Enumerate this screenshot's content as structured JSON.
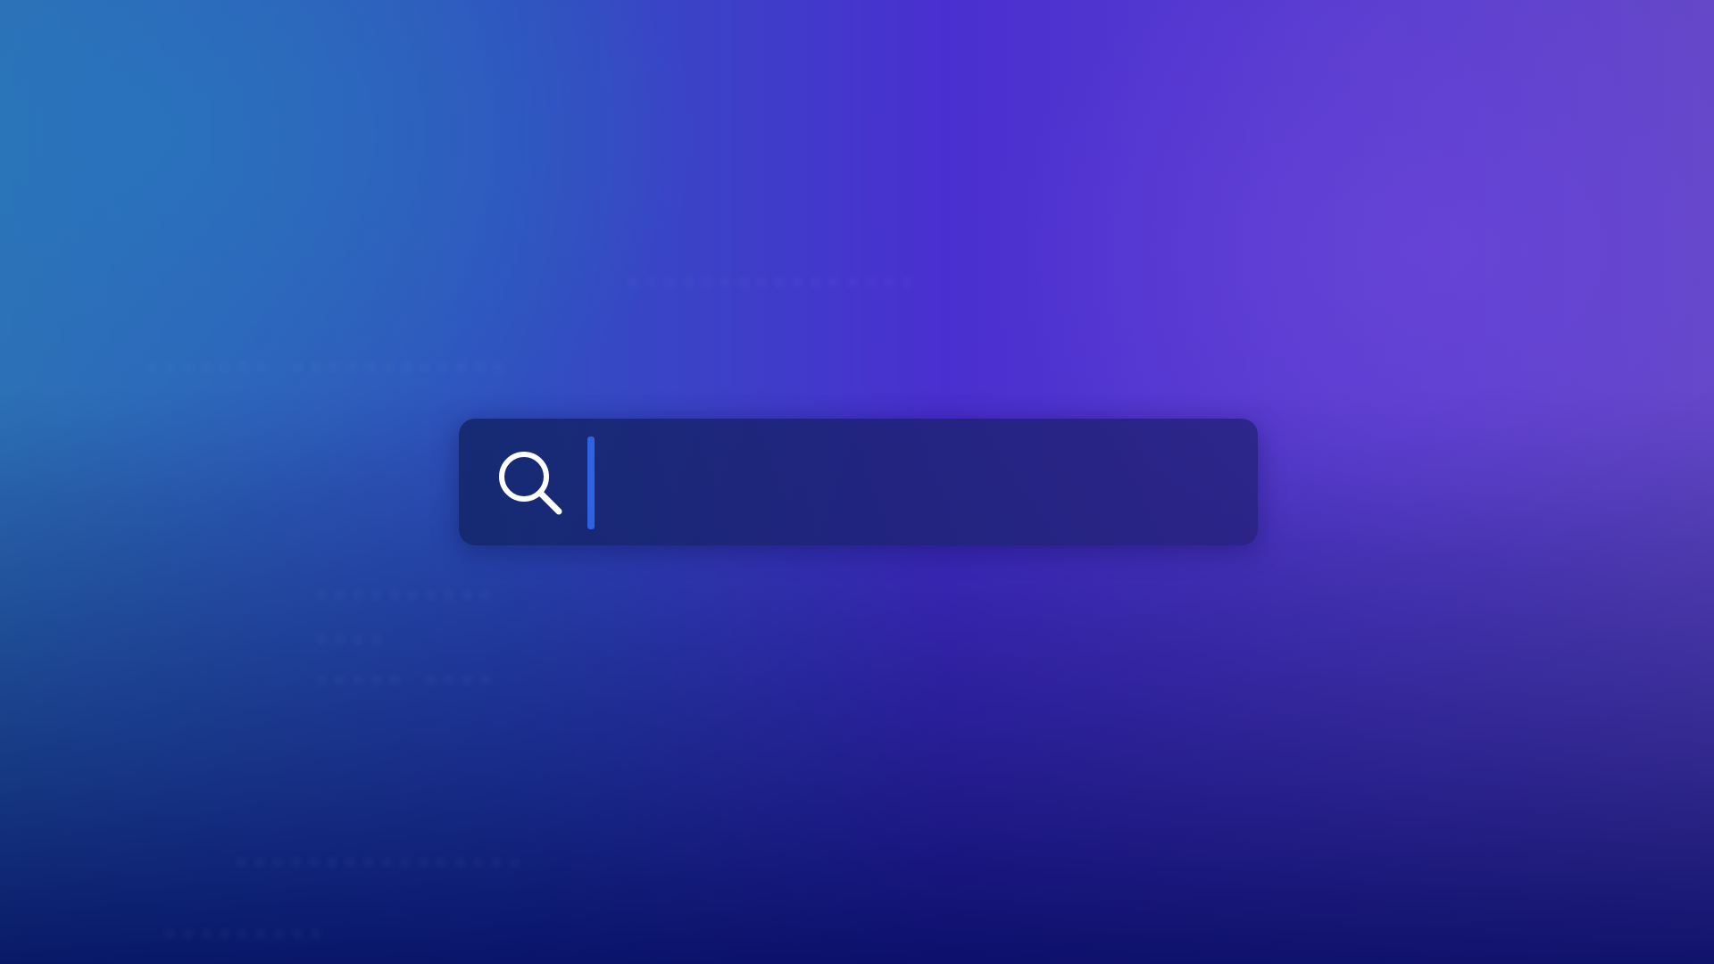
{
  "search": {
    "value": "",
    "placeholder": "",
    "icon": "search-icon"
  },
  "colors": {
    "background_top_left": "#2d6fb5",
    "background_top_right": "#6448c8",
    "background_bottom": "#05137a",
    "search_bar_fill": "#1c2a78",
    "caret": "#2f62e0",
    "icon": "#ffffff"
  }
}
